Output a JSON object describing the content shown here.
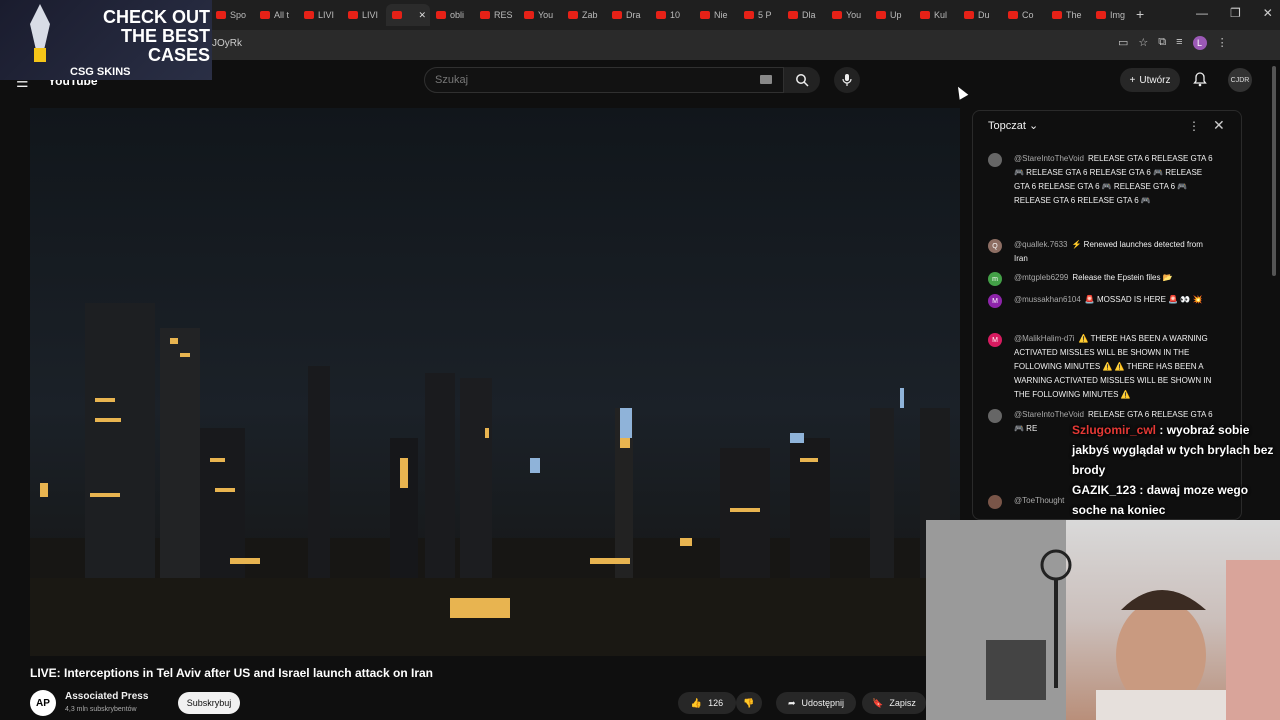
{
  "browser": {
    "tabs": [
      {
        "label": "Spo",
        "active": false
      },
      {
        "label": "All t",
        "active": false
      },
      {
        "label": "LIVI",
        "active": false
      },
      {
        "label": "LIVI",
        "active": false
      },
      {
        "label": "",
        "active": true
      },
      {
        "label": "obli",
        "active": false
      },
      {
        "label": "RES",
        "active": false
      },
      {
        "label": "You",
        "active": false
      },
      {
        "label": "Zab",
        "active": false
      },
      {
        "label": "Dra",
        "active": false
      },
      {
        "label": "10",
        "active": false
      },
      {
        "label": "Nie",
        "active": false
      },
      {
        "label": "5 P",
        "active": false
      },
      {
        "label": "Dla",
        "active": false
      },
      {
        "label": "You",
        "active": false
      },
      {
        "label": "Up",
        "active": false
      },
      {
        "label": "Kul",
        "active": false
      },
      {
        "label": "Du",
        "active": false
      },
      {
        "label": "Co",
        "active": false
      },
      {
        "label": "The",
        "active": false
      },
      {
        "label": "Img",
        "active": false
      }
    ],
    "url_fragment": "JOyRk",
    "profile_initial": "L"
  },
  "ad": {
    "title": "CHECK OUT THE BEST CASES",
    "brand": "CSG SKINS"
  },
  "header": {
    "logo": "YouTube",
    "search_placeholder": "Szukaj",
    "create_label": "Utwórz",
    "avatar_text": "CJDR"
  },
  "video": {
    "title": "LIVE: Interceptions in Tel Aviv after US and Israel launch attack on Iran",
    "channel": "Associated Press",
    "channel_logo": "AP",
    "subscribers": "4,3 mln subskrybentów",
    "subscribe_label": "Subskrybuj",
    "likes": "126",
    "share_label": "Udostępnij",
    "save_label": "Zapisz"
  },
  "chat": {
    "title": "Topczat",
    "messages": [
      {
        "author": "@StareIntoTheVoid",
        "initial": "",
        "color": "#666666",
        "text": "RELEASE GTA 6 RELEASE GTA 6 🎮 RELEASE GTA 6 RELEASE GTA 6 🎮 RELEASE GTA 6 RELEASE GTA 6 🎮 RELEASE GTA 6 🎮 RELEASE GTA 6 RELEASE GTA 6 🎮"
      },
      {
        "author": "@quallek.7633",
        "initial": "Q",
        "color": "#8d6e63",
        "text": "⚡ Renewed launches detected from Iran"
      },
      {
        "author": "@mtgpleb6299",
        "initial": "m",
        "color": "#43a047",
        "text": "Release the Epstein files 📂"
      },
      {
        "author": "@mussakhan6104",
        "initial": "M",
        "color": "#8e24aa",
        "text": "🚨 MOSSAD IS HERE 🚨 👀 💥"
      },
      {
        "author": "@MalikHalim-d7i",
        "initial": "M",
        "color": "#d81b60",
        "text": "⚠️ THERE HAS BEEN A WARNING ACTIVATED MISSLES WILL BE SHOWN IN THE FOLLOWING MINUTES ⚠️ ⚠️ THERE HAS BEEN A WARNING ACTIVATED MISSLES WILL BE SHOWN IN THE FOLLOWING MINUTES ⚠️"
      },
      {
        "author": "@StareIntoTheVoid",
        "initial": "",
        "color": "#666666",
        "text": "RELEASE GTA 6 RELEASE GTA 6 🎮 RE"
      },
      {
        "author": "@ToeThought",
        "initial": "",
        "color": "#795548",
        "text": ""
      }
    ]
  },
  "stream_overlay": {
    "chat": [
      {
        "user": "Szlugomir_cwl",
        "text": "wyobraź sobie jakbyś wyglądał w tych brylach bez brody"
      },
      {
        "user": "GAZIK_123",
        "text": "dawaj moze wego soche na koniec"
      }
    ]
  },
  "colors": {
    "background": "#0f0f0f",
    "brand_red": "#e62117",
    "chat_username_red": "#e53935"
  }
}
